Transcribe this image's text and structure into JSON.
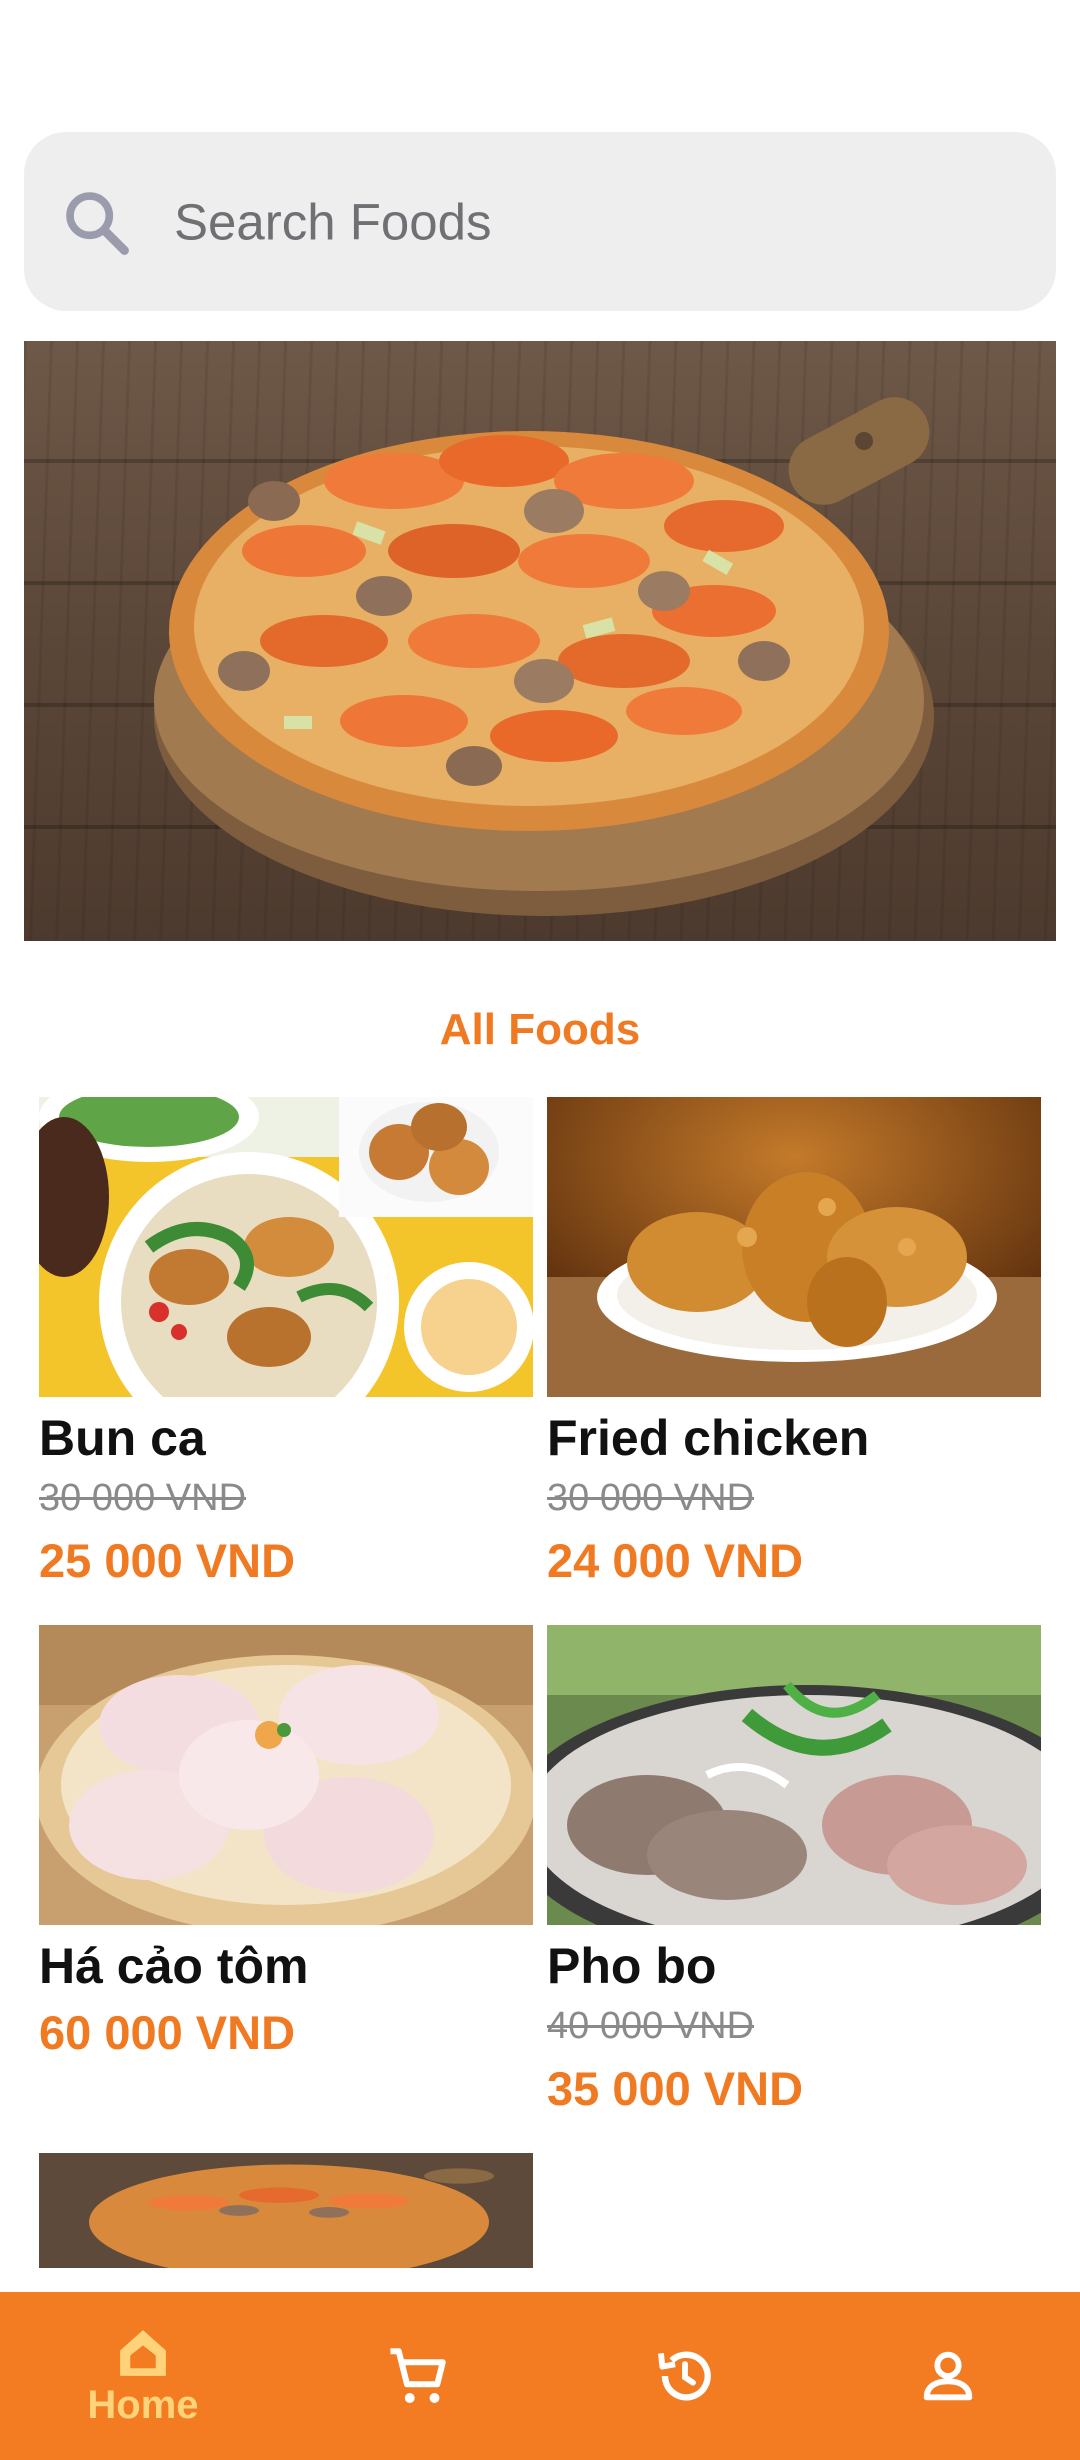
{
  "search": {
    "placeholder": "Search Foods",
    "icon": "search-icon"
  },
  "banner": {
    "image": "mushroom chicken pizza on wooden board"
  },
  "section_title": "All Foods",
  "foods": [
    {
      "name": "Bun ca",
      "old_price": "30 000 VND",
      "price": "25 000 VND"
    },
    {
      "name": "Fried chicken",
      "old_price": "30 000 VND",
      "price": "24 000 VND"
    },
    {
      "name": "Há cảo tôm",
      "price": "60 000 VND"
    },
    {
      "name": "Pho bo",
      "old_price": "40 000 VND",
      "price": "35 000 VND"
    }
  ],
  "nav": {
    "items": [
      {
        "label": "Home",
        "icon": "home-icon",
        "active": true
      },
      {
        "icon": "cart-icon"
      },
      {
        "icon": "history-icon"
      },
      {
        "icon": "profile-icon"
      }
    ]
  },
  "colors": {
    "accent": "#f07a22",
    "nav_background": "#f37b22",
    "nav_active": "#ffd37a",
    "search_background": "#eeeeee"
  }
}
